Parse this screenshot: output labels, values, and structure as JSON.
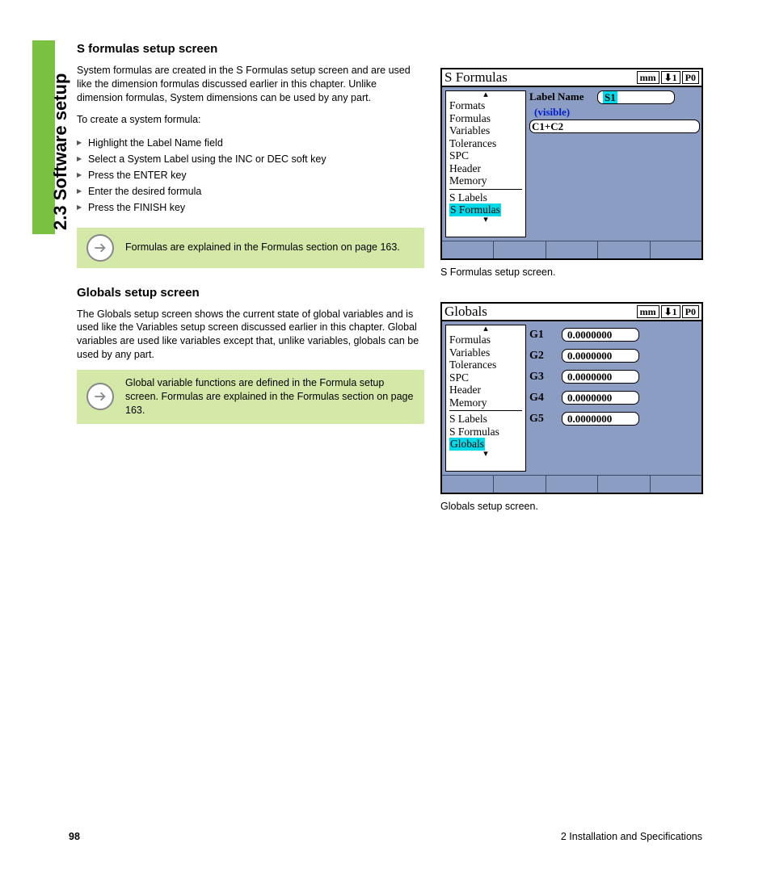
{
  "sideTab": "2.3 Software setup",
  "section1": {
    "heading": "S formulas setup screen",
    "para1": "System formulas are created in the S Formulas setup screen and are used like the dimension formulas discussed earlier in this chapter. Unlike dimension formulas, System dimensions can be used by any part.",
    "para2": "To create a system formula:",
    "steps": [
      "Highlight the Label Name field",
      "Select a System Label using the INC or DEC soft key",
      "Press the ENTER key",
      "Enter the desired formula",
      "Press the FINISH key"
    ],
    "note": "Formulas are explained in the Formulas section on page 163."
  },
  "section2": {
    "heading": "Globals setup screen",
    "para1": "The Globals setup screen shows the current state of global variables and is used like the Variables setup screen discussed earlier in this chapter. Global variables are used like variables except that, unlike variables, globals can be used by any part.",
    "note": "Global variable functions are defined in the Formula setup screen. Formulas are explained in the Formulas section on page 163."
  },
  "panel1": {
    "title": "S Formulas",
    "indicators": [
      "mm",
      "⬇1",
      "P0"
    ],
    "sidebar": [
      "Formats",
      "Formulas",
      "Variables",
      "Tolerances",
      "SPC",
      "Header",
      "Memory"
    ],
    "sidebar2": [
      "S  Labels",
      "S  Formulas"
    ],
    "highlighted": "S  Formulas",
    "fieldLabel": "Label Name",
    "fieldValue": "S1",
    "subLabel": "(visible)",
    "formula": "C1+C2",
    "caption": "S Formulas setup screen."
  },
  "panel2": {
    "title": "Globals",
    "indicators": [
      "mm",
      "⬇1",
      "P0"
    ],
    "sidebar": [
      "Formulas",
      "Variables",
      "Tolerances",
      "SPC",
      "Header",
      "Memory"
    ],
    "sidebar2": [
      "S  Labels",
      "S  Formulas",
      "Globals"
    ],
    "highlighted": "Globals",
    "rows": [
      {
        "label": "G1",
        "value": "0.0000000"
      },
      {
        "label": "G2",
        "value": "0.0000000"
      },
      {
        "label": "G3",
        "value": "0.0000000"
      },
      {
        "label": "G4",
        "value": "0.0000000"
      },
      {
        "label": "G5",
        "value": "0.0000000"
      }
    ],
    "caption": "Globals setup screen."
  },
  "footer": {
    "pageNum": "98",
    "chapter": "2 Installation and Specifications"
  }
}
